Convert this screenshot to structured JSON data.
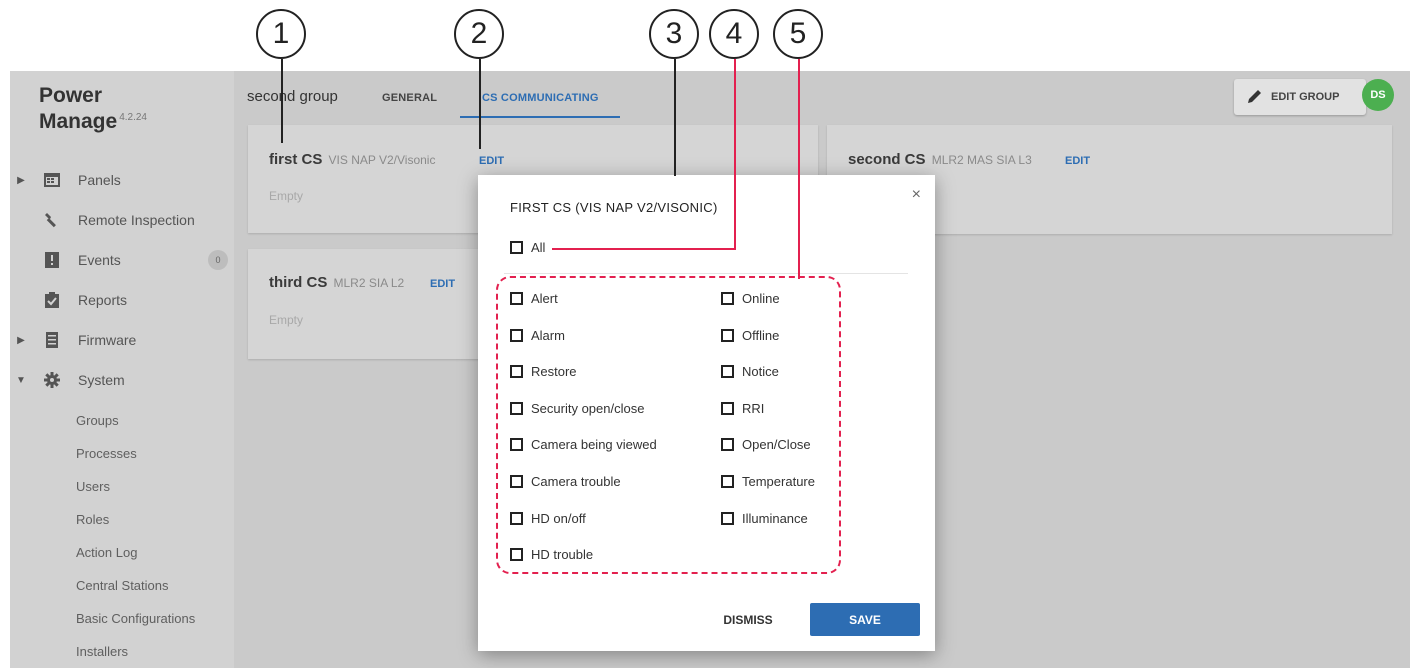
{
  "callouts": [
    "1",
    "2",
    "3",
    "4",
    "5"
  ],
  "app": {
    "name_line1": "Power",
    "name_line2": "Manage",
    "version": "4.2.24"
  },
  "sidebar": {
    "items": [
      {
        "label": "Panels",
        "icon": "panel-icon",
        "expandable": true
      },
      {
        "label": "Remote Inspection",
        "icon": "wrench-icon"
      },
      {
        "label": "Events",
        "icon": "events-icon",
        "badge": "0"
      },
      {
        "label": "Reports",
        "icon": "reports-icon"
      },
      {
        "label": "Firmware",
        "icon": "firmware-icon",
        "expandable": true
      },
      {
        "label": "System",
        "icon": "gear-icon",
        "expanded": true
      }
    ],
    "system_sub": [
      "Groups",
      "Processes",
      "Users",
      "Roles",
      "Action Log",
      "Central Stations",
      "Basic Configurations",
      "Installers"
    ]
  },
  "header": {
    "group_title": "second group",
    "tabs": [
      "GENERAL",
      "CS COMMUNICATING"
    ],
    "active_tab": "CS COMMUNICATING",
    "edit_group_label": "EDIT GROUP",
    "avatar": "DS"
  },
  "cs_cards": [
    {
      "name": "first CS",
      "sub": "VIS NAP V2/Visonic",
      "edit": "EDIT",
      "empty": "Empty"
    },
    {
      "name": "second CS",
      "sub": "MLR2 MAS SIA L3",
      "edit": "EDIT",
      "empty": ""
    },
    {
      "name": "third CS",
      "sub": "MLR2 SIA L2",
      "edit": "EDIT",
      "empty": "Empty"
    }
  ],
  "modal": {
    "title": "FIRST CS (VIS NAP V2/VISONIC)",
    "close": "×",
    "all_label": "All",
    "left_options": [
      "Alert",
      "Alarm",
      "Restore",
      "Security open/close",
      "Camera being viewed",
      "Camera trouble",
      "HD on/off",
      "HD trouble"
    ],
    "right_options": [
      "Online",
      "Offline",
      "Notice",
      "RRI",
      "Open/Close",
      "Temperature",
      "Illuminance"
    ],
    "dismiss": "DISMISS",
    "save": "SAVE"
  },
  "colors": {
    "accent": "#2d6db3",
    "annotation": "#e3204f",
    "avatar": "#4caf50"
  }
}
